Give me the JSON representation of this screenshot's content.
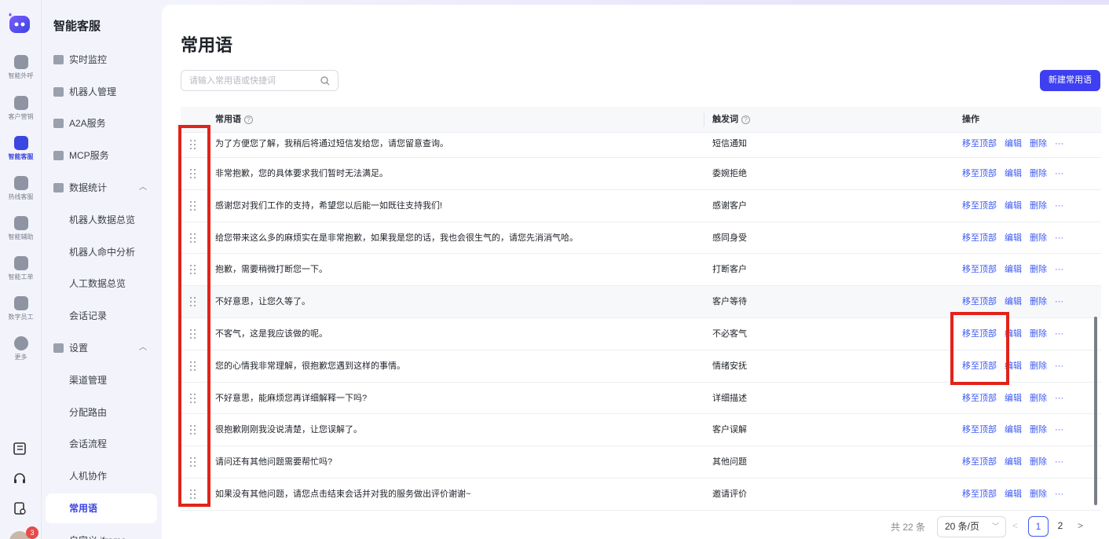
{
  "rail": {
    "items": [
      {
        "label": "智能外呼",
        "icon": "phone-user-icon"
      },
      {
        "label": "客户营销",
        "icon": "group-icon"
      },
      {
        "label": "智能客服",
        "icon": "bot-icon",
        "active": true
      },
      {
        "label": "热线客服",
        "icon": "phone-icon"
      },
      {
        "label": "智能辅助",
        "icon": "assist-icon"
      },
      {
        "label": "智能工单",
        "icon": "clipboard-icon"
      },
      {
        "label": "数字员工",
        "icon": "badge-icon"
      },
      {
        "label": "更多",
        "icon": "more-icon"
      }
    ],
    "badge_count": "3"
  },
  "sidebar": {
    "title": "智能客服",
    "items": [
      {
        "label": "实时监控"
      },
      {
        "label": "机器人管理"
      },
      {
        "label": "A2A服务"
      },
      {
        "label": "MCP服务"
      },
      {
        "label": "数据统计"
      },
      {
        "label": "机器人数据总览"
      },
      {
        "label": "机器人命中分析"
      },
      {
        "label": "人工数据总览"
      },
      {
        "label": "会话记录"
      },
      {
        "label": "设置"
      },
      {
        "label": "渠道管理"
      },
      {
        "label": "分配路由"
      },
      {
        "label": "会话流程"
      },
      {
        "label": "人机协作"
      },
      {
        "label": "常用语"
      },
      {
        "label": "自定义 iframe"
      }
    ]
  },
  "page": {
    "title": "常用语",
    "search_placeholder": "请输入常用语或快捷词",
    "new_button": "新建常用语"
  },
  "table": {
    "headers": {
      "phrase": "常用语",
      "trigger": "触发词",
      "actions": "操作"
    },
    "action_labels": {
      "top": "移至顶部",
      "edit": "编辑",
      "delete": "删除",
      "more": "···"
    },
    "rows": [
      {
        "phrase": "为了方便您了解，我稍后将通过短信发给您，请您留意查询。",
        "trigger": "短信通知"
      },
      {
        "phrase": "非常抱歉，您的具体要求我们暂时无法满足。",
        "trigger": "委婉拒绝"
      },
      {
        "phrase": "感谢您对我们工作的支持，希望您以后能一如既往支持我们!",
        "trigger": "感谢客户"
      },
      {
        "phrase": "给您带来这么多的麻烦实在是非常抱歉，如果我是您的话，我也会很生气的，请您先消消气哈。",
        "trigger": "感同身受"
      },
      {
        "phrase": "抱歉，需要稍微打断您一下。",
        "trigger": "打断客户"
      },
      {
        "phrase": "不好意思，让您久等了。",
        "trigger": "客户等待"
      },
      {
        "phrase": "不客气，这是我应该做的呢。",
        "trigger": "不必客气"
      },
      {
        "phrase": "您的心情我非常理解，很抱歉您遇到这样的事情。",
        "trigger": "情绪安抚"
      },
      {
        "phrase": "不好意思，能麻烦您再详细解释一下吗?",
        "trigger": "详细描述"
      },
      {
        "phrase": "很抱歉刚刚我没说清楚，让您误解了。",
        "trigger": "客户误解"
      },
      {
        "phrase": "请问还有其他问题需要帮忙吗?",
        "trigger": "其他问题"
      },
      {
        "phrase": "如果没有其他问题，请您点击结束会话并对我的服务做出评价谢谢~",
        "trigger": "邀请评价"
      }
    ]
  },
  "pagination": {
    "total": "共 22 条",
    "page_size": "20 条/页",
    "pages": [
      "1",
      "2"
    ],
    "current": "1"
  },
  "colors": {
    "accent": "#3d3ff0",
    "link": "#3d5af1",
    "annotation": "#e2231a"
  }
}
